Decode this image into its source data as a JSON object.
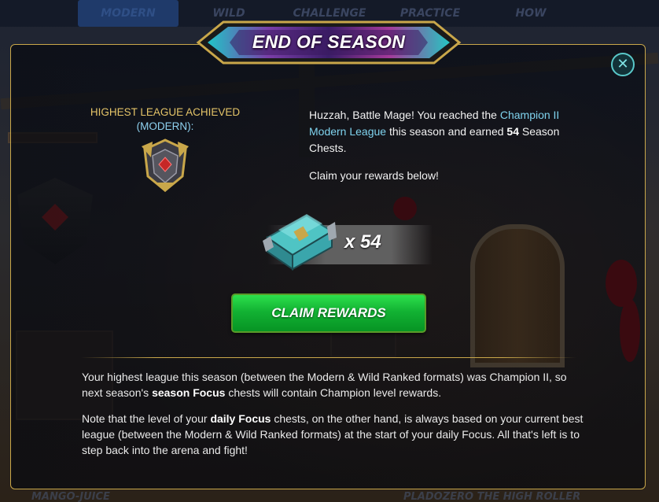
{
  "background_nav": {
    "tabs": [
      "MODERN",
      "WILD",
      "CHALLENGE",
      "PRACTICE",
      "HOW"
    ]
  },
  "background_bottom": {
    "left_text": "MANGO-JUICE",
    "right_text": "PLADOZERO THE HIGH ROLLER"
  },
  "modal": {
    "title": "END OF SEASON",
    "close_icon": "close-icon",
    "league_heading_line1": "HIGHEST LEAGUE ACHIEVED",
    "league_heading_line2": "(MODERN):",
    "league_badge_icon": "champion-league-badge-icon",
    "message": {
      "intro": "Huzzah, Battle Mage! You reached the ",
      "league_name": "Champion II Modern League",
      "mid": " this season and earned ",
      "chest_count": "54",
      "outro": " Season Chests."
    },
    "claim_prompt": "Claim your rewards below!",
    "reward": {
      "icon": "season-chest-icon",
      "count_text": "x 54"
    },
    "claim_button_label": "CLAIM REWARDS",
    "info_paragraph_1": {
      "before": "Your highest league this season (between the Modern & Wild Ranked formats) was Champion II, so next season's ",
      "bold": "season Focus",
      "after": " chests will contain Champion level rewards."
    },
    "info_paragraph_2": {
      "before": "Note that the level of your ",
      "bold": "daily Focus",
      "after": " chests, on the other hand, is always based on your current best league (between the Modern & Wild Ranked formats) at the start of your daily Focus. All that's left is to step back into the arena and fight!"
    }
  },
  "colors": {
    "gold_border": "#c9a74a",
    "league_heading": "#e4c468",
    "league_highlight": "#7fd3ee",
    "claim_button": "#12b233",
    "close_button": "#59c8c9"
  }
}
